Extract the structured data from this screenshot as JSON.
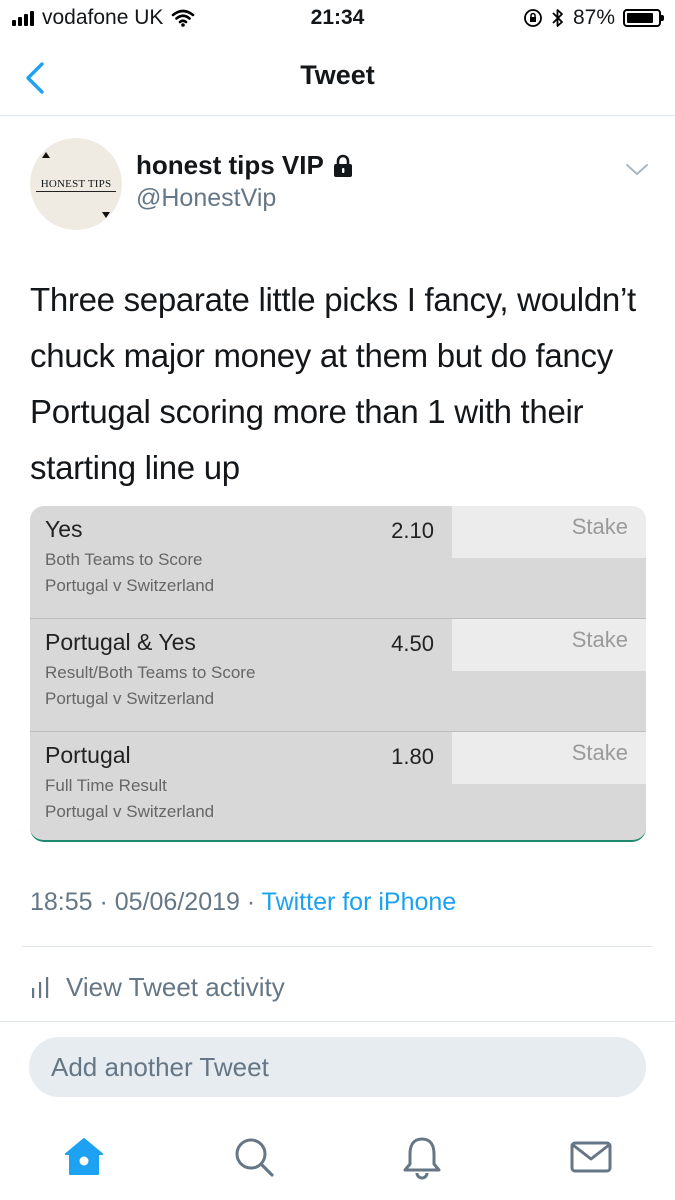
{
  "status_bar": {
    "carrier": "vodafone UK",
    "time": "21:34",
    "battery": "87%",
    "battery_level": 0.87
  },
  "nav": {
    "title": "Tweet"
  },
  "tweet": {
    "display_name": "honest tips VIP",
    "handle": "@HonestVip",
    "avatar_text": "HONEST TIPS",
    "text": "Three separate little picks I fancy, wouldn’t chuck major money at them but do fancy Portugal scoring more than 1 with their starting line up",
    "timestamp": "18:55 · 05/06/2019 · ",
    "source": "Twitter for iPhone"
  },
  "betslip": {
    "bets": [
      {
        "selection": "Yes",
        "market": "Both Teams to Score",
        "event": "Portugal v Switzerland",
        "odds": "2.10",
        "stake_placeholder": "Stake"
      },
      {
        "selection": "Portugal & Yes",
        "market": "Result/Both Teams to Score",
        "event": "Portugal v Switzerland",
        "odds": "4.50",
        "stake_placeholder": "Stake"
      },
      {
        "selection": "Portugal",
        "market": "Full Time Result",
        "event": "Portugal v Switzerland",
        "odds": "1.80",
        "stake_placeholder": "Stake"
      }
    ],
    "accent_color": "#1f8a70"
  },
  "activity": {
    "label": "View Tweet activity"
  },
  "reply": {
    "placeholder": "Add another Tweet"
  },
  "tab_bar": {
    "active_color": "#1da1f2",
    "tabs": [
      "home-icon",
      "search-icon",
      "notifications-icon",
      "messages-icon"
    ]
  }
}
